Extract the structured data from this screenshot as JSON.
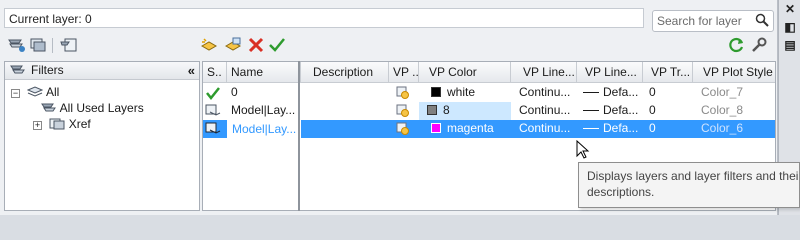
{
  "header": {
    "current_layer_label": "Current layer: 0",
    "search_placeholder": "Search for layer"
  },
  "filters_panel": {
    "title": "Filters",
    "tree": [
      {
        "label": "All"
      },
      {
        "label": "All Used Layers"
      },
      {
        "label": "Xref"
      }
    ]
  },
  "grid": {
    "columns": [
      "S..",
      "Name",
      "Description",
      "VP ...",
      "VP Color",
      "VP Line...",
      "VP Line...",
      "VP Tr...",
      "VP Plot Style"
    ],
    "rows": [
      {
        "status": "current",
        "name": "0",
        "description": "",
        "color_name": "white",
        "color_hex": "#000000",
        "linetype": "Continu...",
        "lineweight": "Defa...",
        "transparency": "0",
        "plot_style": "Color_7",
        "selected": false
      },
      {
        "status": "layer",
        "name": "Model|Lay...",
        "description": "",
        "color_name": "8",
        "color_hex": "#808080",
        "linetype": "Continu...",
        "lineweight": "Defa...",
        "transparency": "0",
        "plot_style": "Color_8",
        "selected": false
      },
      {
        "status": "layer",
        "name": "Model|Lay...",
        "description": "",
        "color_name": "magenta",
        "color_hex": "#ff00ff",
        "linetype": "Continu...",
        "lineweight": "Defa...",
        "transparency": "0",
        "plot_style": "Color_6",
        "selected": true
      }
    ]
  },
  "tooltip": {
    "line1": "Displays layers and layer filters and their p",
    "line2": "descriptions."
  },
  "colors": {
    "selection": "#3399ff",
    "accent_green": "#2e9b2e",
    "delete_red": "#d93025"
  }
}
